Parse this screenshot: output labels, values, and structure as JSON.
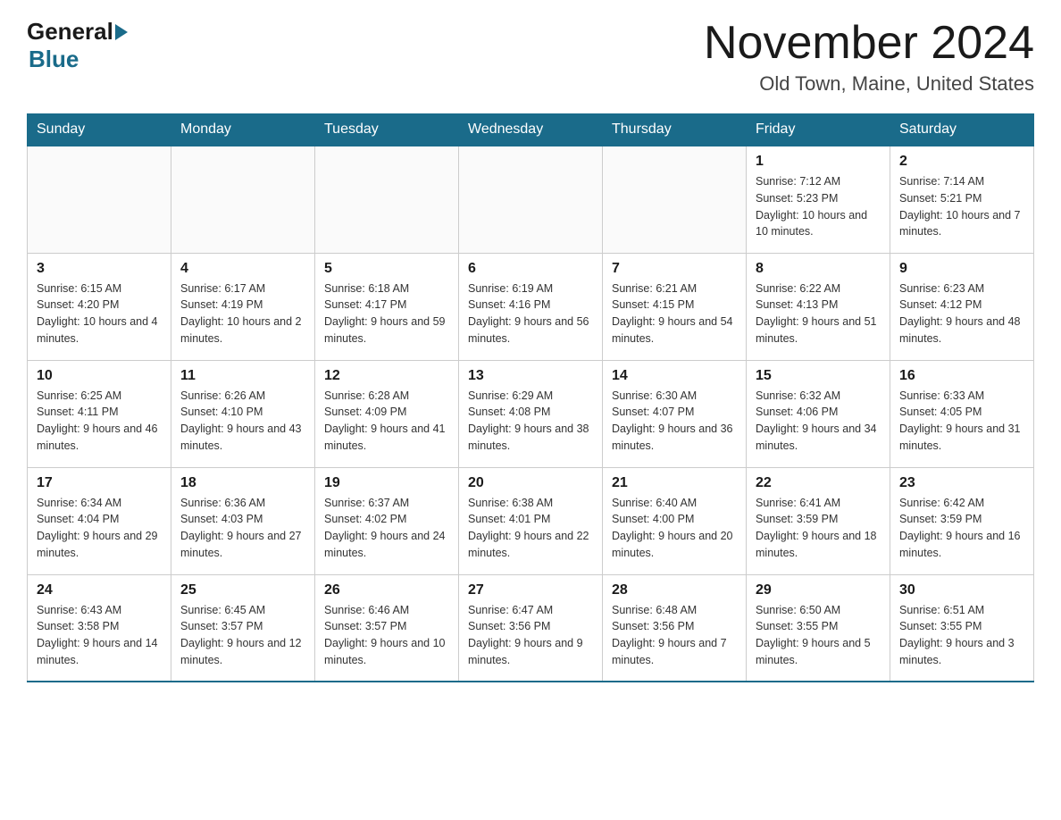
{
  "header": {
    "logo_general": "General",
    "logo_blue": "Blue",
    "month_title": "November 2024",
    "location": "Old Town, Maine, United States"
  },
  "days_of_week": [
    "Sunday",
    "Monday",
    "Tuesday",
    "Wednesday",
    "Thursday",
    "Friday",
    "Saturday"
  ],
  "weeks": [
    [
      {
        "day": "",
        "info": ""
      },
      {
        "day": "",
        "info": ""
      },
      {
        "day": "",
        "info": ""
      },
      {
        "day": "",
        "info": ""
      },
      {
        "day": "",
        "info": ""
      },
      {
        "day": "1",
        "info": "Sunrise: 7:12 AM\nSunset: 5:23 PM\nDaylight: 10 hours and 10 minutes."
      },
      {
        "day": "2",
        "info": "Sunrise: 7:14 AM\nSunset: 5:21 PM\nDaylight: 10 hours and 7 minutes."
      }
    ],
    [
      {
        "day": "3",
        "info": "Sunrise: 6:15 AM\nSunset: 4:20 PM\nDaylight: 10 hours and 4 minutes."
      },
      {
        "day": "4",
        "info": "Sunrise: 6:17 AM\nSunset: 4:19 PM\nDaylight: 10 hours and 2 minutes."
      },
      {
        "day": "5",
        "info": "Sunrise: 6:18 AM\nSunset: 4:17 PM\nDaylight: 9 hours and 59 minutes."
      },
      {
        "day": "6",
        "info": "Sunrise: 6:19 AM\nSunset: 4:16 PM\nDaylight: 9 hours and 56 minutes."
      },
      {
        "day": "7",
        "info": "Sunrise: 6:21 AM\nSunset: 4:15 PM\nDaylight: 9 hours and 54 minutes."
      },
      {
        "day": "8",
        "info": "Sunrise: 6:22 AM\nSunset: 4:13 PM\nDaylight: 9 hours and 51 minutes."
      },
      {
        "day": "9",
        "info": "Sunrise: 6:23 AM\nSunset: 4:12 PM\nDaylight: 9 hours and 48 minutes."
      }
    ],
    [
      {
        "day": "10",
        "info": "Sunrise: 6:25 AM\nSunset: 4:11 PM\nDaylight: 9 hours and 46 minutes."
      },
      {
        "day": "11",
        "info": "Sunrise: 6:26 AM\nSunset: 4:10 PM\nDaylight: 9 hours and 43 minutes."
      },
      {
        "day": "12",
        "info": "Sunrise: 6:28 AM\nSunset: 4:09 PM\nDaylight: 9 hours and 41 minutes."
      },
      {
        "day": "13",
        "info": "Sunrise: 6:29 AM\nSunset: 4:08 PM\nDaylight: 9 hours and 38 minutes."
      },
      {
        "day": "14",
        "info": "Sunrise: 6:30 AM\nSunset: 4:07 PM\nDaylight: 9 hours and 36 minutes."
      },
      {
        "day": "15",
        "info": "Sunrise: 6:32 AM\nSunset: 4:06 PM\nDaylight: 9 hours and 34 minutes."
      },
      {
        "day": "16",
        "info": "Sunrise: 6:33 AM\nSunset: 4:05 PM\nDaylight: 9 hours and 31 minutes."
      }
    ],
    [
      {
        "day": "17",
        "info": "Sunrise: 6:34 AM\nSunset: 4:04 PM\nDaylight: 9 hours and 29 minutes."
      },
      {
        "day": "18",
        "info": "Sunrise: 6:36 AM\nSunset: 4:03 PM\nDaylight: 9 hours and 27 minutes."
      },
      {
        "day": "19",
        "info": "Sunrise: 6:37 AM\nSunset: 4:02 PM\nDaylight: 9 hours and 24 minutes."
      },
      {
        "day": "20",
        "info": "Sunrise: 6:38 AM\nSunset: 4:01 PM\nDaylight: 9 hours and 22 minutes."
      },
      {
        "day": "21",
        "info": "Sunrise: 6:40 AM\nSunset: 4:00 PM\nDaylight: 9 hours and 20 minutes."
      },
      {
        "day": "22",
        "info": "Sunrise: 6:41 AM\nSunset: 3:59 PM\nDaylight: 9 hours and 18 minutes."
      },
      {
        "day": "23",
        "info": "Sunrise: 6:42 AM\nSunset: 3:59 PM\nDaylight: 9 hours and 16 minutes."
      }
    ],
    [
      {
        "day": "24",
        "info": "Sunrise: 6:43 AM\nSunset: 3:58 PM\nDaylight: 9 hours and 14 minutes."
      },
      {
        "day": "25",
        "info": "Sunrise: 6:45 AM\nSunset: 3:57 PM\nDaylight: 9 hours and 12 minutes."
      },
      {
        "day": "26",
        "info": "Sunrise: 6:46 AM\nSunset: 3:57 PM\nDaylight: 9 hours and 10 minutes."
      },
      {
        "day": "27",
        "info": "Sunrise: 6:47 AM\nSunset: 3:56 PM\nDaylight: 9 hours and 9 minutes."
      },
      {
        "day": "28",
        "info": "Sunrise: 6:48 AM\nSunset: 3:56 PM\nDaylight: 9 hours and 7 minutes."
      },
      {
        "day": "29",
        "info": "Sunrise: 6:50 AM\nSunset: 3:55 PM\nDaylight: 9 hours and 5 minutes."
      },
      {
        "day": "30",
        "info": "Sunrise: 6:51 AM\nSunset: 3:55 PM\nDaylight: 9 hours and 3 minutes."
      }
    ]
  ]
}
